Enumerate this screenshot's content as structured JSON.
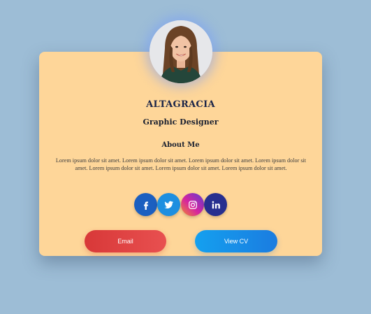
{
  "profile": {
    "name": "ALTAGRACIA",
    "role": "Graphic Designer",
    "avatar_icon": "person-photo"
  },
  "about": {
    "title": "About Me",
    "text": "Lorem ipsum dolor sit amet. Lorem ipsum dolor sit amet. Lorem ipsum dolor sit amet. Lorem ipsum dolor sit amet. Lorem ipsum dolor sit amet. Lorem ipsum dolor sit amet. Lorem ipsum dolor sit amet."
  },
  "socials": [
    {
      "icon": "facebook-icon",
      "color": "#1b5fc0"
    },
    {
      "icon": "twitter-icon",
      "color": "#1e8fe0"
    },
    {
      "icon": "instagram-icon",
      "color": "#d6249f"
    },
    {
      "icon": "linkedin-icon",
      "color": "#272f8f"
    }
  ],
  "buttons": {
    "email_label": "Email",
    "cv_label": "View CV"
  },
  "colors": {
    "background": "#9dbdd6",
    "card": "#fed699",
    "email_button": "#dd3c3c",
    "cv_button": "#1590ea"
  }
}
